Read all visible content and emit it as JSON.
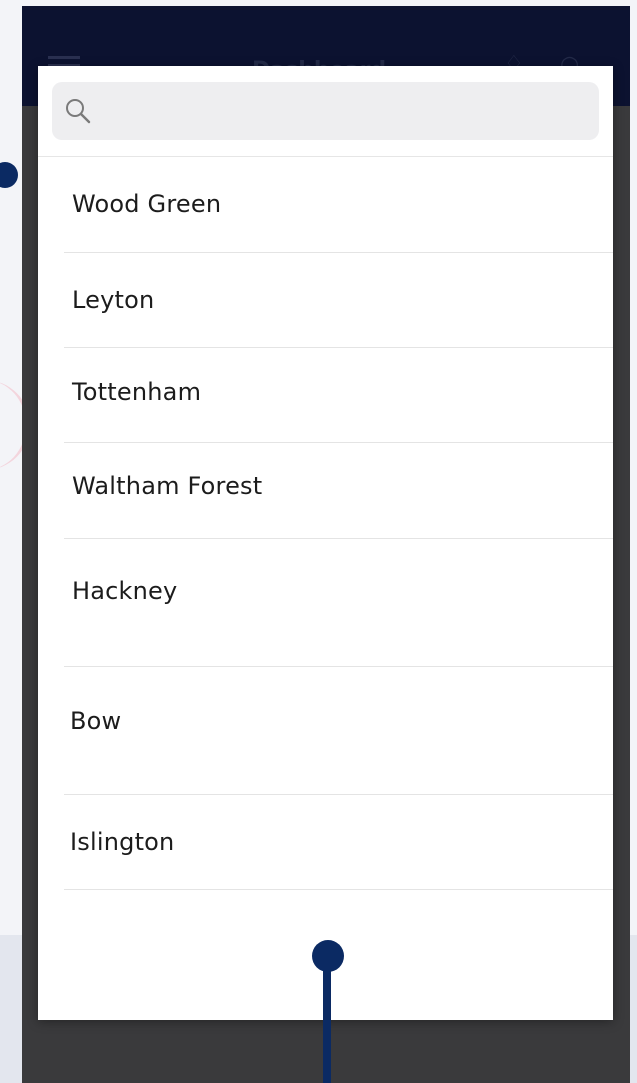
{
  "header": {
    "title": "Dashboard"
  },
  "search": {
    "value": "",
    "placeholder": ""
  },
  "locations": [
    {
      "label": "Wood Green"
    },
    {
      "label": "Leyton"
    },
    {
      "label": "Tottenham"
    },
    {
      "label": "Waltham Forest"
    },
    {
      "label": "Hackney"
    },
    {
      "label": "Bow"
    },
    {
      "label": "Islington"
    }
  ],
  "colors": {
    "header_bg": "#0c1230",
    "overlay_bg": "#3a3a3c",
    "accent": "#0b2a63",
    "search_bg": "#eeeef0"
  },
  "icons": [
    "search-icon",
    "menu-icon",
    "bell-icon",
    "user-icon"
  ]
}
